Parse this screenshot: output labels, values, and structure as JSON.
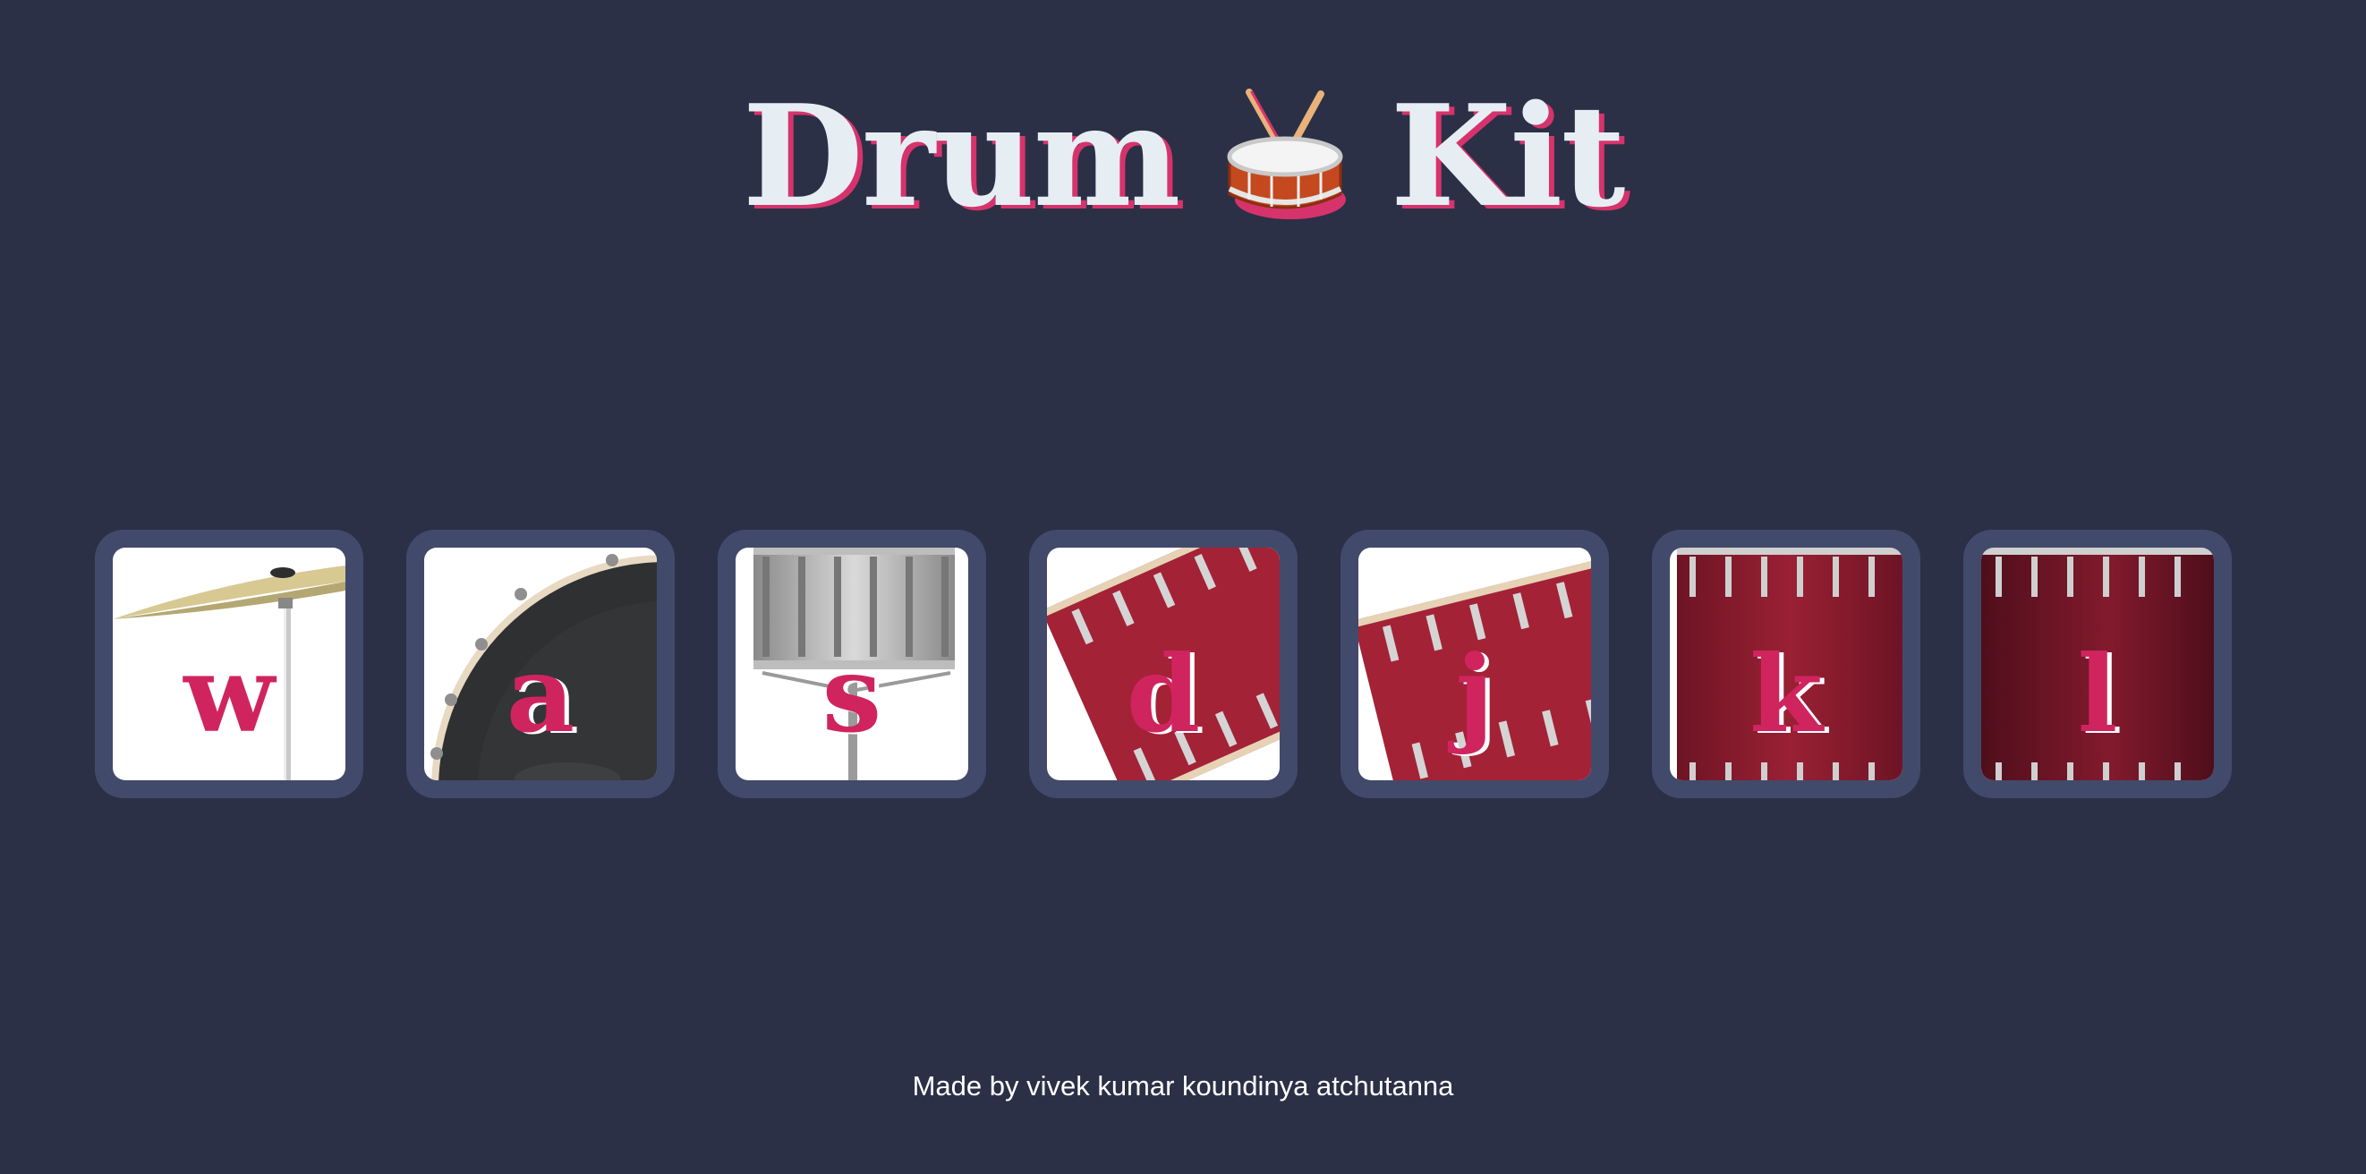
{
  "title": {
    "word_left": "Drum",
    "word_right": "Kit",
    "emoji_icon": "drum-with-drumsticks-icon"
  },
  "keys": [
    {
      "letter": "w",
      "instrument": "cymbal"
    },
    {
      "letter": "a",
      "instrument": "bass-drum"
    },
    {
      "letter": "s",
      "instrument": "snare-drum"
    },
    {
      "letter": "d",
      "instrument": "tom-1"
    },
    {
      "letter": "j",
      "instrument": "tom-2"
    },
    {
      "letter": "k",
      "instrument": "tom-3"
    },
    {
      "letter": "l",
      "instrument": "floor-tom"
    }
  ],
  "footer": {
    "text": "Made by vivek kumar koundinya atchutanna"
  },
  "colors": {
    "background": "#2b3046",
    "key_frame": "#424a6b",
    "letter": "#d0245f",
    "title": "#e6eef3",
    "title_shadow": "#d6336c"
  }
}
